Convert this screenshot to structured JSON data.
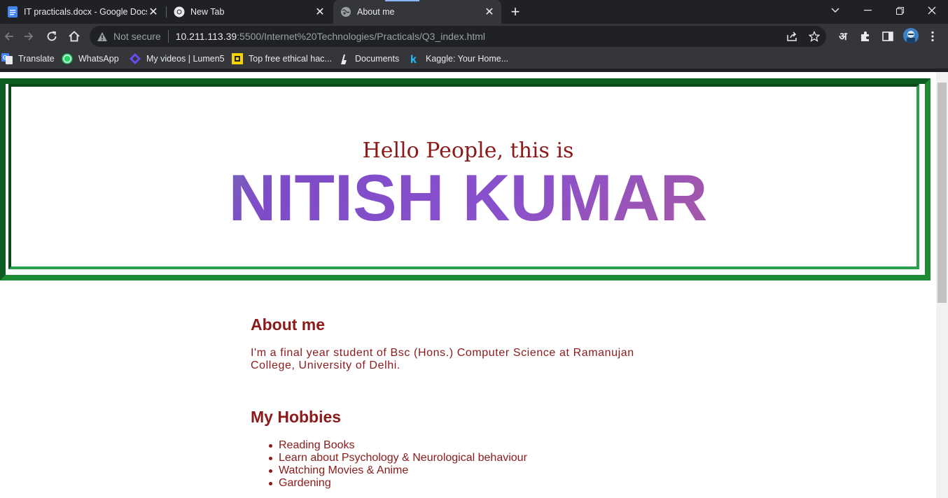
{
  "browser": {
    "tabs": [
      {
        "title": "IT practicals.docx - Google Docs",
        "icon": "google-docs-icon",
        "active": false
      },
      {
        "title": "New Tab",
        "icon": "chrome-icon",
        "active": false
      },
      {
        "title": "About me",
        "icon": "globe-icon",
        "active": true
      }
    ],
    "omnibox": {
      "security_label": "Not secure",
      "url_host": "10.211.113.39",
      "url_rest": ":5500/Internet%20Technologies/Practicals/Q3_index.html"
    },
    "translate_glyph": "अ",
    "bookmarks": [
      {
        "label": "Translate",
        "icon": "google-translate-icon"
      },
      {
        "label": "WhatsApp",
        "icon": "whatsapp-icon"
      },
      {
        "label": "My videos | Lumen5",
        "icon": "lumen5-icon"
      },
      {
        "label": "Top free ethical hac...",
        "icon": "yellow-square-icon"
      },
      {
        "label": "Documents",
        "icon": "documents-icon"
      },
      {
        "label": "Kaggle: Your Home...",
        "icon": "kaggle-icon"
      }
    ]
  },
  "page": {
    "greeting": "Hello People, this is",
    "name": "NITISH KUMAR",
    "about": {
      "title": "About me",
      "text": "I'm a final year student of Bsc (Hons.) Computer Science at Ramanujan College, University of Delhi."
    },
    "hobbies": {
      "title": "My Hobbies",
      "items": [
        "Reading Books",
        "Learn about Psychology & Neurological behaviour",
        "Watching Movies & Anime",
        "Gardening"
      ]
    }
  },
  "colors": {
    "text_accent": "#8b1a1a",
    "banner_border": "#1e8c34",
    "browser_dark": "#202124",
    "toolbar": "#35363a"
  }
}
